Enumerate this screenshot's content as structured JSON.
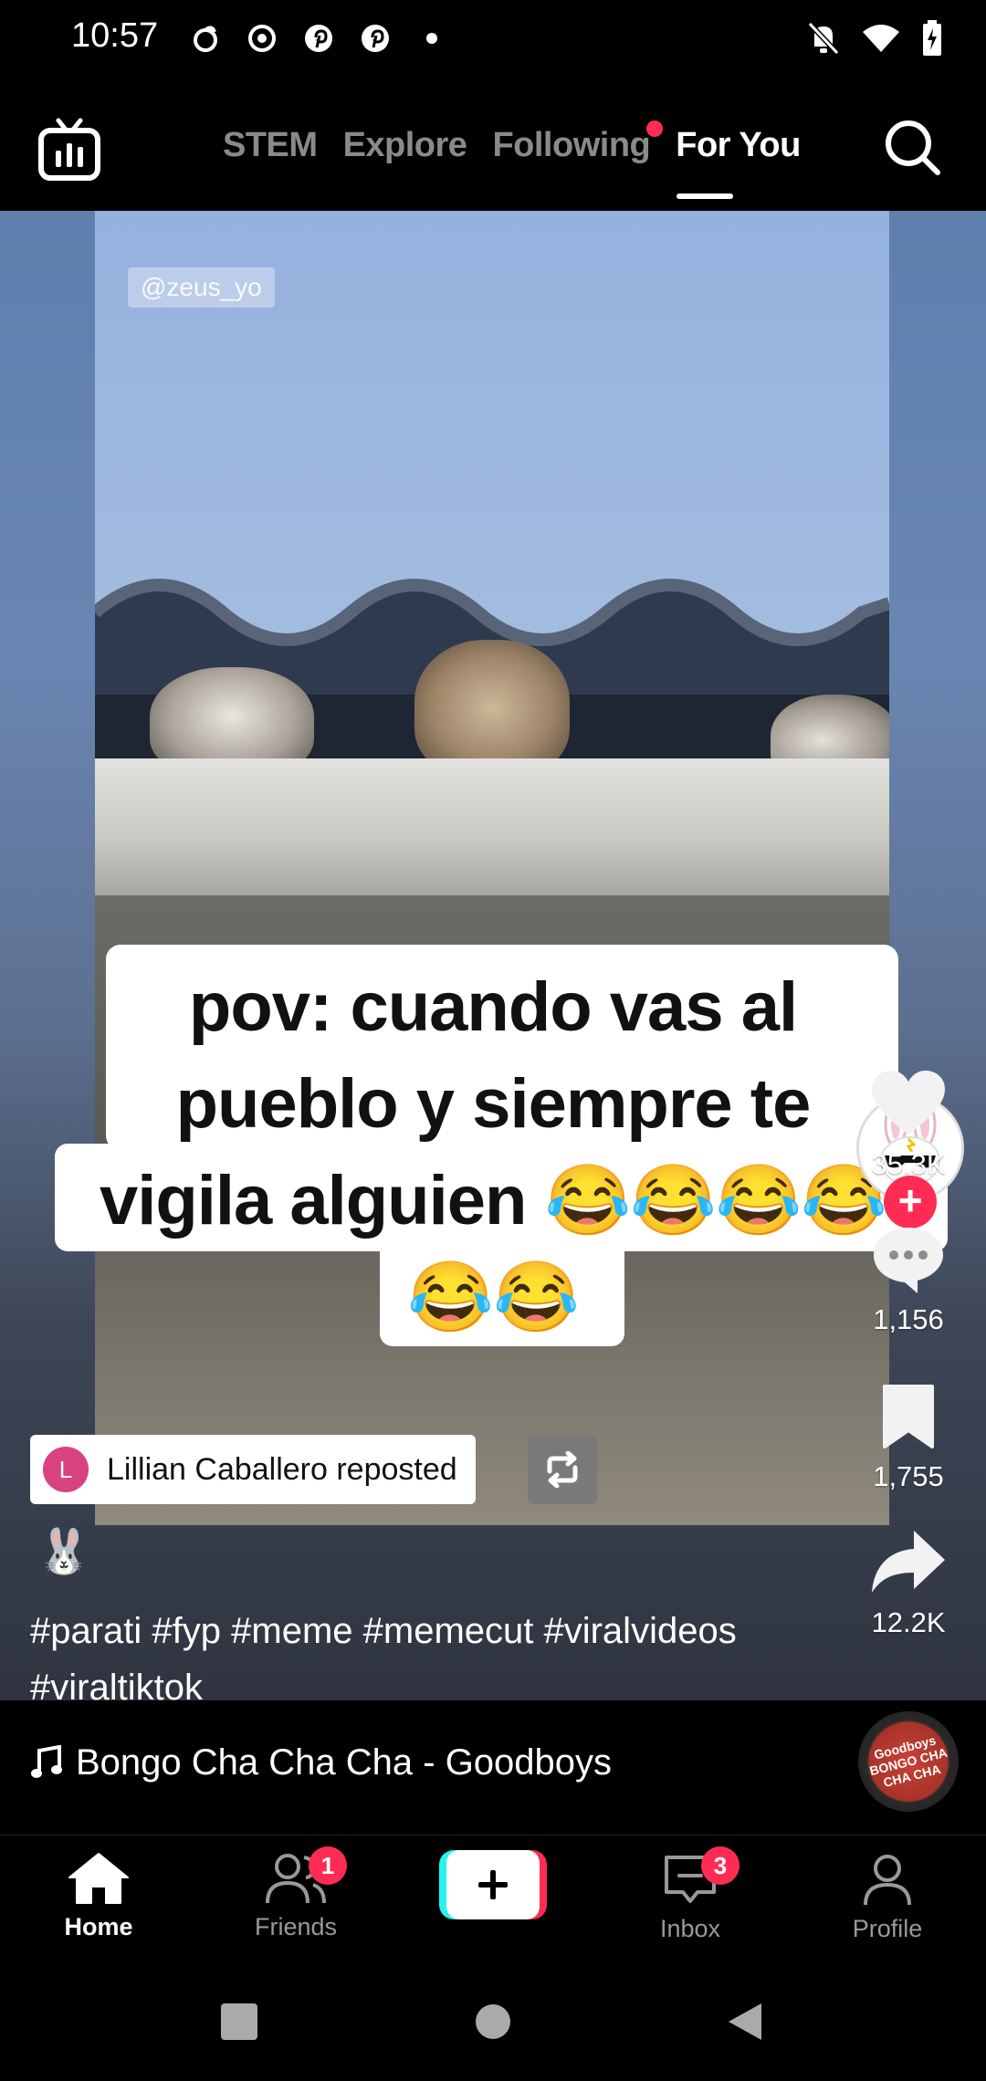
{
  "status_bar": {
    "time": "10:57"
  },
  "top_nav": {
    "tabs": [
      {
        "label": "STEM"
      },
      {
        "label": "Explore"
      },
      {
        "label": "Following"
      },
      {
        "label": "For You"
      }
    ],
    "active_tab": "For You",
    "following_has_dot": true
  },
  "video": {
    "watermark": "@zeus_yo",
    "caption_lines": [
      "pov: cuando vas al",
      "pueblo y siempre te",
      "vigila alguien 😂😂😂😂",
      "😂😂"
    ]
  },
  "actions": {
    "likes": "35.3K",
    "comments": "1,156",
    "saves": "1,755",
    "shares": "12.2K"
  },
  "repost": {
    "initial": "L",
    "label": "Lillian Caballero reposted"
  },
  "author_emoji": "🐰",
  "description": "#parati #fyp #meme #memecut #viralvideos #viraltiktok",
  "music": {
    "title": "Bongo Cha Cha Cha - Goodboys",
    "disc_text": "Goodboys BONGO CHA CHA CHA"
  },
  "bottom_nav": {
    "home": "Home",
    "friends": "Friends",
    "friends_badge": "1",
    "inbox": "Inbox",
    "inbox_badge": "3",
    "profile": "Profile"
  },
  "colors": {
    "accent": "#fe2c55",
    "background": "#000000"
  }
}
